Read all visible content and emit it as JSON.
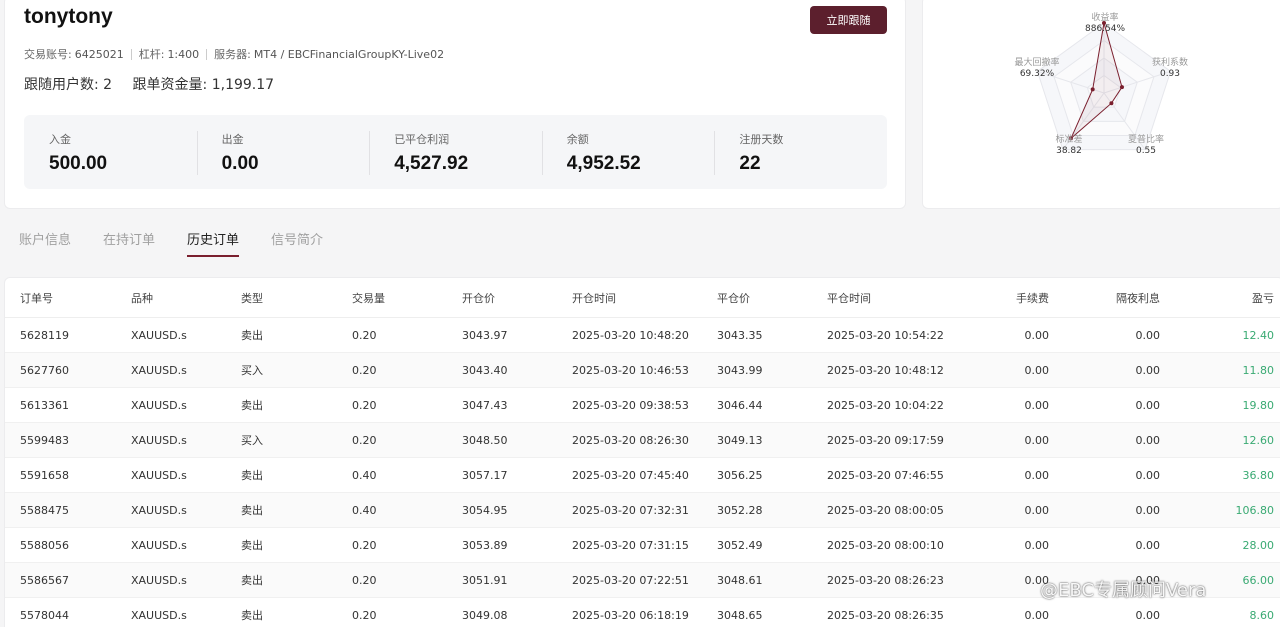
{
  "profile": {
    "name": "tonytony",
    "follow_button": "立即跟随",
    "account_label": "交易账号:",
    "account_value": "6425021",
    "leverage_label": "杠杆:",
    "leverage_value": "1:400",
    "server_label": "服务器:",
    "server_value": "MT4 / EBCFinancialGroupKY-Live02",
    "followers_label": "跟随用户数:",
    "followers_value": "2",
    "funds_label": "跟单资金量:",
    "funds_value": "1,199.17"
  },
  "stats": [
    {
      "label": "入金",
      "value": "500.00"
    },
    {
      "label": "出金",
      "value": "0.00"
    },
    {
      "label": "已平仓利润",
      "value": "4,527.92"
    },
    {
      "label": "余额",
      "value": "4,952.52"
    },
    {
      "label": "注册天数",
      "value": "22"
    }
  ],
  "radar": {
    "axes": [
      {
        "label": "收益率",
        "value": "886.54%",
        "level": 1.0
      },
      {
        "label": "获利系数",
        "value": "0.93",
        "level": 0.27
      },
      {
        "label": "夏普比率",
        "value": "0.55",
        "level": 0.18
      },
      {
        "label": "标准差",
        "value": "38.82",
        "level": 0.8
      },
      {
        "label": "最大回撤率",
        "value": "69.32%",
        "level": 0.17
      }
    ],
    "line_color": "#7a1f2e"
  },
  "tabs": [
    "账户信息",
    "在持订单",
    "历史订单",
    "信号简介"
  ],
  "active_tab": 2,
  "table": {
    "headers": [
      "订单号",
      "品种",
      "类型",
      "交易量",
      "开仓价",
      "开仓时间",
      "平仓价",
      "平仓时间",
      "手续费",
      "隔夜利息",
      "盈亏"
    ],
    "rows": [
      [
        "5628119",
        "XAUUSD.s",
        "卖出",
        "0.20",
        "3043.97",
        "2025-03-20 10:48:20",
        "3043.35",
        "2025-03-20 10:54:22",
        "0.00",
        "0.00",
        "12.40"
      ],
      [
        "5627760",
        "XAUUSD.s",
        "买入",
        "0.20",
        "3043.40",
        "2025-03-20 10:46:53",
        "3043.99",
        "2025-03-20 10:48:12",
        "0.00",
        "0.00",
        "11.80"
      ],
      [
        "5613361",
        "XAUUSD.s",
        "卖出",
        "0.20",
        "3047.43",
        "2025-03-20 09:38:53",
        "3046.44",
        "2025-03-20 10:04:22",
        "0.00",
        "0.00",
        "19.80"
      ],
      [
        "5599483",
        "XAUUSD.s",
        "买入",
        "0.20",
        "3048.50",
        "2025-03-20 08:26:30",
        "3049.13",
        "2025-03-20 09:17:59",
        "0.00",
        "0.00",
        "12.60"
      ],
      [
        "5591658",
        "XAUUSD.s",
        "卖出",
        "0.40",
        "3057.17",
        "2025-03-20 07:45:40",
        "3056.25",
        "2025-03-20 07:46:55",
        "0.00",
        "0.00",
        "36.80"
      ],
      [
        "5588475",
        "XAUUSD.s",
        "卖出",
        "0.40",
        "3054.95",
        "2025-03-20 07:32:31",
        "3052.28",
        "2025-03-20 08:00:05",
        "0.00",
        "0.00",
        "106.80"
      ],
      [
        "5588056",
        "XAUUSD.s",
        "卖出",
        "0.20",
        "3053.89",
        "2025-03-20 07:31:15",
        "3052.49",
        "2025-03-20 08:00:10",
        "0.00",
        "0.00",
        "28.00"
      ],
      [
        "5586567",
        "XAUUSD.s",
        "卖出",
        "0.20",
        "3051.91",
        "2025-03-20 07:22:51",
        "3048.61",
        "2025-03-20 08:26:23",
        "0.00",
        "0.00",
        "66.00"
      ],
      [
        "5578044",
        "XAUUSD.s",
        "卖出",
        "0.20",
        "3049.08",
        "2025-03-20 06:18:19",
        "3048.65",
        "2025-03-20 08:26:35",
        "0.00",
        "0.00",
        "8.60"
      ]
    ],
    "profit_color": "#3aaa73"
  },
  "watermark": "@EBC专属顾问Vera"
}
